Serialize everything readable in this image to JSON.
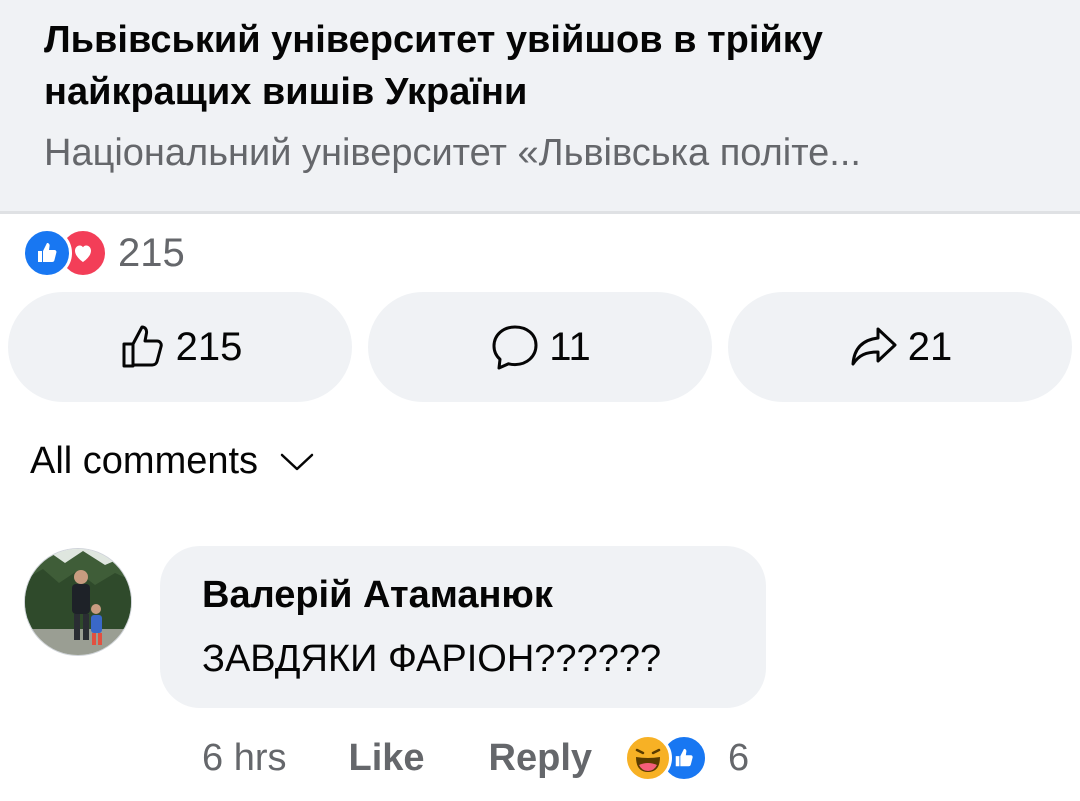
{
  "link_card": {
    "title": "Львівський університет увійшов в трійку найкращих вишів України",
    "subtitle": "Національний університет «Львівська політе..."
  },
  "reactions": {
    "icons": [
      "like-icon",
      "love-icon"
    ],
    "count": "215"
  },
  "actions": {
    "like_count": "215",
    "comment_count": "11",
    "share_count": "21"
  },
  "comments_filter": {
    "label": "All comments"
  },
  "comment": {
    "author": "Валерій Атаманюк",
    "text": "ЗАВДЯКИ  ФАРІОН??????",
    "time": "6 hrs",
    "like_label": "Like",
    "reply_label": "Reply",
    "reaction_icons": [
      "haha-icon",
      "like-icon"
    ],
    "reaction_count": "6"
  },
  "colors": {
    "like_blue": "#1877f2",
    "love_red": "#f33e58",
    "haha_yellow": "#f7b125",
    "secondary_text": "#65676b",
    "card_bg": "#f0f2f5"
  }
}
